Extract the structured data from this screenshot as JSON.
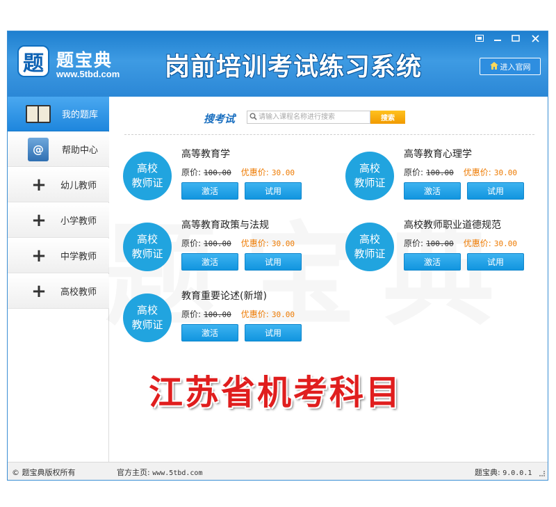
{
  "header": {
    "logo_char": "题",
    "logo_name": "题宝典",
    "logo_url": "www.5tbd.com",
    "title": "岗前培训考试练习系统",
    "enter_site_label": "进入官网",
    "window_controls": [
      "settings-icon",
      "minimize-icon",
      "maximize-icon",
      "close-icon"
    ]
  },
  "sidebar": {
    "items": [
      {
        "label": "我的题库",
        "icon": "notebook-icon",
        "active": true
      },
      {
        "label": "帮助中心",
        "icon": "help-book-icon",
        "active": false
      },
      {
        "label": "幼儿教师",
        "icon": "plus-icon",
        "active": false
      },
      {
        "label": "小学教师",
        "icon": "plus-icon",
        "active": false
      },
      {
        "label": "中学教师",
        "icon": "plus-icon",
        "active": false
      },
      {
        "label": "高校教师",
        "icon": "plus-icon",
        "active": false
      }
    ]
  },
  "search": {
    "label": "搜考试",
    "placeholder": "请输入课程名称进行搜索",
    "button": "搜索"
  },
  "courses": [
    {
      "badge_line1": "高校",
      "badge_line2": "教师证",
      "name": "高等教育学",
      "orig_label": "原价:",
      "orig_price": "100.00",
      "sale_label": "优惠价:",
      "sale_price": "30.00",
      "activate": "激活",
      "trial": "试用"
    },
    {
      "badge_line1": "高校",
      "badge_line2": "教师证",
      "name": "高等教育心理学",
      "orig_label": "原价:",
      "orig_price": "100.00",
      "sale_label": "优惠价:",
      "sale_price": "30.00",
      "activate": "激活",
      "trial": "试用"
    },
    {
      "badge_line1": "高校",
      "badge_line2": "教师证",
      "name": "高等教育政策与法规",
      "orig_label": "原价:",
      "orig_price": "100.00",
      "sale_label": "优惠价:",
      "sale_price": "30.00",
      "activate": "激活",
      "trial": "试用"
    },
    {
      "badge_line1": "高校",
      "badge_line2": "教师证",
      "name": "高校教师职业道德规范",
      "orig_label": "原价:",
      "orig_price": "100.00",
      "sale_label": "优惠价:",
      "sale_price": "30.00",
      "activate": "激活",
      "trial": "试用"
    },
    {
      "badge_line1": "高校",
      "badge_line2": "教师证",
      "name": "教育重要论述(新增)",
      "orig_label": "原价:",
      "orig_price": "100.00",
      "sale_label": "优惠价:",
      "sale_price": "30.00",
      "activate": "激活",
      "trial": "试用"
    }
  ],
  "watermark": "题宝典",
  "promo": "江苏省机考科目",
  "footer": {
    "copyright": "© 题宝典版权所有",
    "homepage_label": "官方主页:",
    "homepage_url": "www.5tbd.com",
    "version_label": "题宝典:",
    "version": "9.0.0.1"
  },
  "colors": {
    "header_blue": "#2b87d6",
    "accent_blue": "#21a4df",
    "search_orange": "#f19a00",
    "sale_orange": "#ee7a00",
    "promo_red": "#e01e1e"
  }
}
